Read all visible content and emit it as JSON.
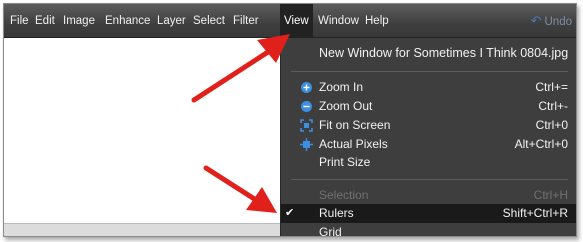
{
  "menubar": {
    "items": [
      "File",
      "Edit",
      "Image",
      "Enhance",
      "Layer",
      "Select",
      "Filter",
      "View",
      "Window",
      "Help"
    ],
    "active": "View",
    "undo_label": "Undo",
    "undo_icon": "undo-arrow-icon"
  },
  "view_menu": {
    "new_window": "New Window for Sometimes I Think 0804.jpg",
    "zoom_in": {
      "label": "Zoom In",
      "shortcut": "Ctrl+=",
      "icon": "zoom-in-icon"
    },
    "zoom_out": {
      "label": "Zoom Out",
      "shortcut": "Ctrl+-",
      "icon": "zoom-out-icon"
    },
    "fit_on_screen": {
      "label": "Fit on Screen",
      "shortcut": "Ctrl+0",
      "icon": "fit-screen-icon"
    },
    "actual_pixels": {
      "label": "Actual Pixels",
      "shortcut": "Alt+Ctrl+0",
      "icon": "actual-pixels-icon"
    },
    "print_size": {
      "label": "Print Size"
    },
    "selection": {
      "label": "Selection",
      "shortcut": "Ctrl+H",
      "disabled": true
    },
    "rulers": {
      "label": "Rulers",
      "shortcut": "Shift+Ctrl+R",
      "checked": true,
      "check_glyph": "✔"
    },
    "grid": {
      "label": "Grid"
    }
  },
  "colors": {
    "menubar": "#3f3f3f",
    "menu_bg": "#3e3e3e",
    "highlight": "#1a1a1a",
    "arrow": "#e0201b",
    "icon_blue": "#3d8fe0"
  }
}
